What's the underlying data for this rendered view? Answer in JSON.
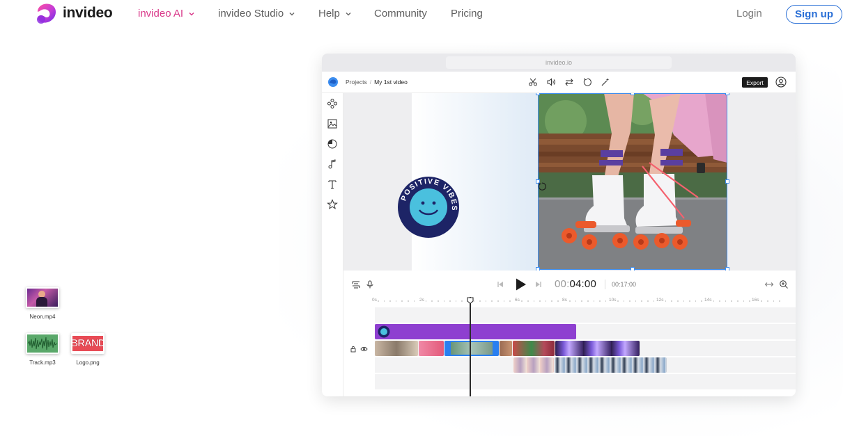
{
  "nav": {
    "brand": "invideo",
    "items": [
      {
        "label": "invideo AI",
        "dropdown": true,
        "active": true
      },
      {
        "label": "invideo Studio",
        "dropdown": true,
        "active": false
      },
      {
        "label": "Help",
        "dropdown": true,
        "active": false
      },
      {
        "label": "Community",
        "dropdown": false,
        "active": false
      },
      {
        "label": "Pricing",
        "dropdown": false,
        "active": false
      }
    ],
    "login": "Login",
    "signup": "Sign up",
    "accent_color": "#d9398a",
    "signup_color": "#2a6fd6"
  },
  "desktop_files": [
    {
      "name": "Neon.mp4",
      "icon": "video-file-icon"
    },
    {
      "name": "Track.mp3",
      "icon": "audio-file-icon"
    },
    {
      "name": "Logo.png",
      "icon": "image-file-icon",
      "logo_text": "BRAND"
    }
  ],
  "editor": {
    "url": "invideo.io",
    "breadcrumb": {
      "root": "Projects",
      "current": "My 1st video"
    },
    "toolbar_icons": [
      "scissors-icon",
      "volume-icon",
      "swap-icon",
      "rotate-icon",
      "magic-wand-icon"
    ],
    "export_label": "Export",
    "sidebar_icons": [
      "elements-icon",
      "media-icon",
      "stickers-icon",
      "music-icon",
      "text-icon",
      "favorites-icon"
    ],
    "sticker_text": "POSITIVE VIBES",
    "transport": {
      "time_prefix": "00:",
      "time_current": "04:00",
      "duration": "00:17:00"
    },
    "ruler_ticks": [
      "0s",
      "2s",
      "4s",
      "6s",
      "8s",
      "10s",
      "12s",
      "14s",
      "16s"
    ],
    "selection_color": "#3d8ef0",
    "text_track_color": "#8e3fd0"
  }
}
